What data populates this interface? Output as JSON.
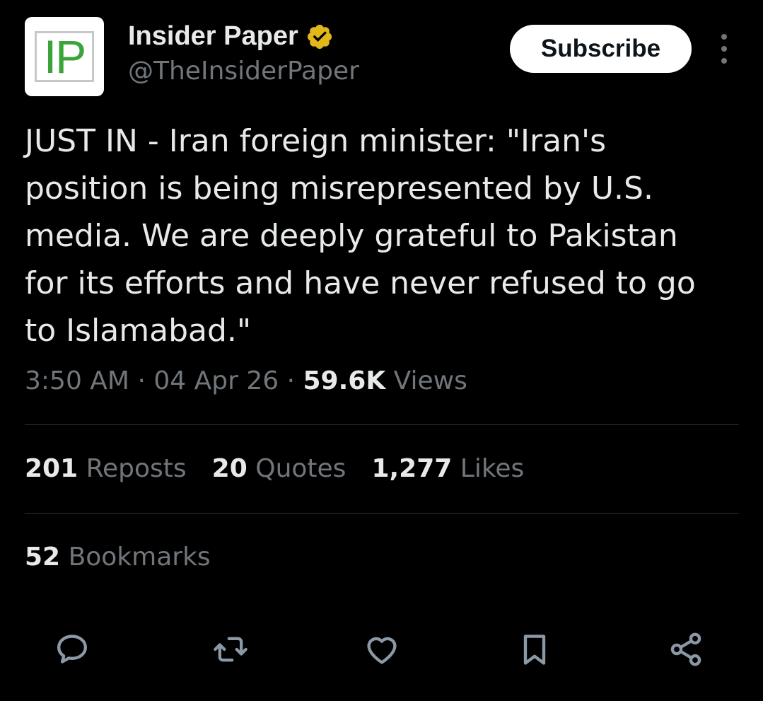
{
  "author": {
    "avatar_text": "IP",
    "display_name": "Insider Paper",
    "handle": "@TheInsiderPaper",
    "verified_icon": "verified-badge-icon",
    "verified_color": "#e2b719"
  },
  "header": {
    "subscribe_label": "Subscribe",
    "more_icon": "more-vertical-icon"
  },
  "tweet": {
    "text": "JUST IN - Iran foreign minister: \"Iran's\nposition is being misrepresented by U.S.\nmedia. We are deeply grateful to Pakistan\nfor its efforts and have never refused to go\nto Islamabad.\""
  },
  "meta": {
    "time": "3:50 AM",
    "separator": "·",
    "date": "04 Apr 26",
    "views_count": "59.6K",
    "views_label": "Views"
  },
  "stats": {
    "reposts_count": "201",
    "reposts_label": "Reposts",
    "quotes_count": "20",
    "quotes_label": "Quotes",
    "likes_count": "1,277",
    "likes_label": "Likes",
    "bookmarks_count": "52",
    "bookmarks_label": "Bookmarks"
  },
  "actions": [
    "reply-icon",
    "repost-icon",
    "like-icon",
    "bookmark-icon",
    "share-icon"
  ],
  "colors": {
    "background": "#000000",
    "text_primary": "#e7e9ea",
    "text_secondary": "#71767b",
    "divider": "#2f3336",
    "avatar_green": "#3aa33a"
  }
}
